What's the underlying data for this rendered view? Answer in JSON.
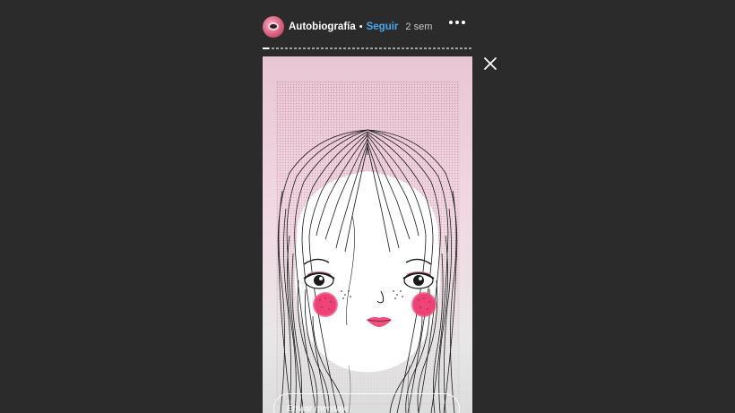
{
  "header": {
    "username": "Autobiografía",
    "separator": "•",
    "follow_label": "Seguir",
    "time_ago": "2 sem",
    "more_icon": "more-horizontal-icon"
  },
  "progress": {
    "segments": 1,
    "fraction": 0.03
  },
  "close_icon": "close-icon",
  "story": {
    "illustration": "girl-portrait-illustration"
  },
  "reply": {
    "placeholder": "Enviar mensaje"
  },
  "colors": {
    "background": "#2b2b2b",
    "follow_link": "#4aa8f0",
    "blush": "#ee3f74",
    "story_top": "#e9c6d4"
  }
}
